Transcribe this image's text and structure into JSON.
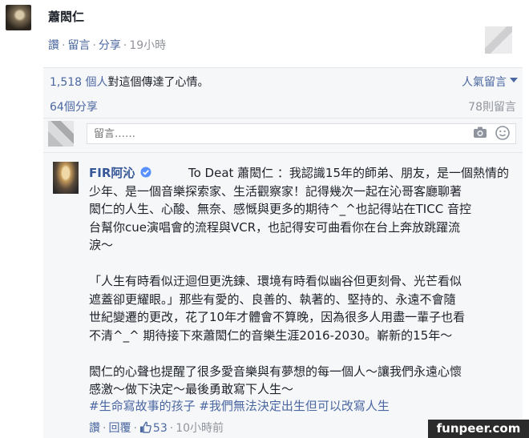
{
  "post": {
    "author": "蕭閎仁",
    "actions": {
      "like": "讚",
      "comment": "留言",
      "share": "分享",
      "time": "19小時"
    }
  },
  "reactions": {
    "count": "1,518 個人",
    "text": "對這個傳達了心情。",
    "sort_label": "人氣留言"
  },
  "stats": {
    "shares": "64個分享",
    "comments": "78則留言"
  },
  "composer": {
    "placeholder": "留言……"
  },
  "comment": {
    "author": "FIR阿沁",
    "to_prefix": "To Deat 蕭閎仁",
    "body": "                          To Deat 蕭閎仁 ：我認識15年的師弟、朋友，是一個熱情的\n少年、是一個音樂探索家、生活觀察家！記得幾次一起在沁哥客廳聊著\n閎仁的人生、心酸、無奈、感慨與更多的期待^_^也記得站在TICC 音控\n台幫你cue演唱會的流程與VCR，也記得安可曲看你在台上奔放跳躍流\n淚～\n\n「人生有時看似迂迴但更洗鍊、環境有時看似幽谷但更刻骨、光芒看似\n遮蓋卻更耀眼。」那些有愛的、良善的、執著的、堅持的、永遠不會隨\n世紀變遷的更改，花了10年才體會不算晚，因為很多人用盡一輩子也看\n不清^_^ 期待接下來蕭閎仁的音樂生涯2016-2030。嶄新的15年～\n\n閎仁的心聲也提醒了很多愛音樂與有夢想的每一個人～讓我們永遠心懷\n感激～做下決定～最後勇敢寫下人生～",
    "hashtags": "#生命寫故事的孩子 #我們無法決定出生但可以改寫人生",
    "actions": {
      "like": "讚",
      "reply": "回覆",
      "like_count": "53",
      "time": "10小時前"
    }
  },
  "watermark": "funpeer.com",
  "colors": {
    "link": "#4b67a1",
    "name": "#365899",
    "bg_gray": "#f6f7f9",
    "meta": "#90949c"
  }
}
